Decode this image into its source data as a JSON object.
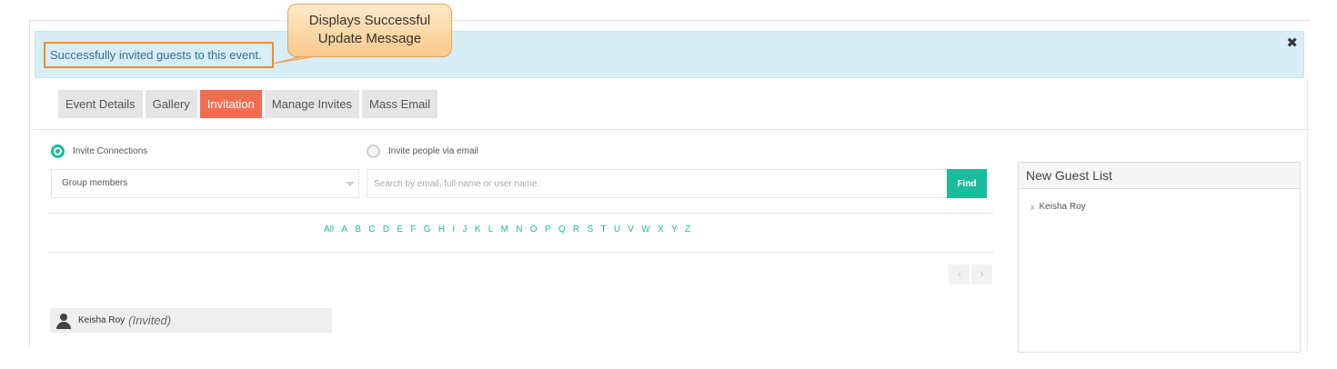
{
  "alert": {
    "message": "Successfully invited guests to this event.",
    "close_symbol": "✖"
  },
  "callout": {
    "line1": "Displays Successful",
    "line2": "Update Message"
  },
  "tabs": [
    {
      "label": "Event Details",
      "active": false
    },
    {
      "label": "Gallery",
      "active": false
    },
    {
      "label": "Invitation",
      "active": true
    },
    {
      "label": "Manage Invites",
      "active": false
    },
    {
      "label": "Mass Email",
      "active": false
    }
  ],
  "invite_options": {
    "connections": {
      "label": "Invite Connections",
      "selected": true
    },
    "email": {
      "label": "Invite people via email",
      "selected": false
    }
  },
  "filter": {
    "selected": "Group members"
  },
  "search": {
    "placeholder": "Search by email, full name or user name.",
    "value": "",
    "button": "Find"
  },
  "alphabet": [
    "All",
    "A",
    "B",
    "C",
    "D",
    "E",
    "F",
    "G",
    "H",
    "I",
    "J",
    "K",
    "L",
    "M",
    "N",
    "O",
    "P",
    "Q",
    "R",
    "S",
    "T",
    "U",
    "V",
    "W",
    "X",
    "Y",
    "Z"
  ],
  "pager": {
    "prev": "‹",
    "next": "›"
  },
  "members": [
    {
      "name": "Keisha Roy",
      "status": "(Invited)"
    }
  ],
  "guest_list": {
    "title": "New Guest List",
    "items": [
      {
        "remove": "x",
        "name": "Keisha Roy"
      }
    ]
  },
  "colors": {
    "accent": "#1bbc9b",
    "active_tab": "#f26d50",
    "alert_bg": "#d9edf7",
    "callout_border": "#ee8b2b"
  }
}
